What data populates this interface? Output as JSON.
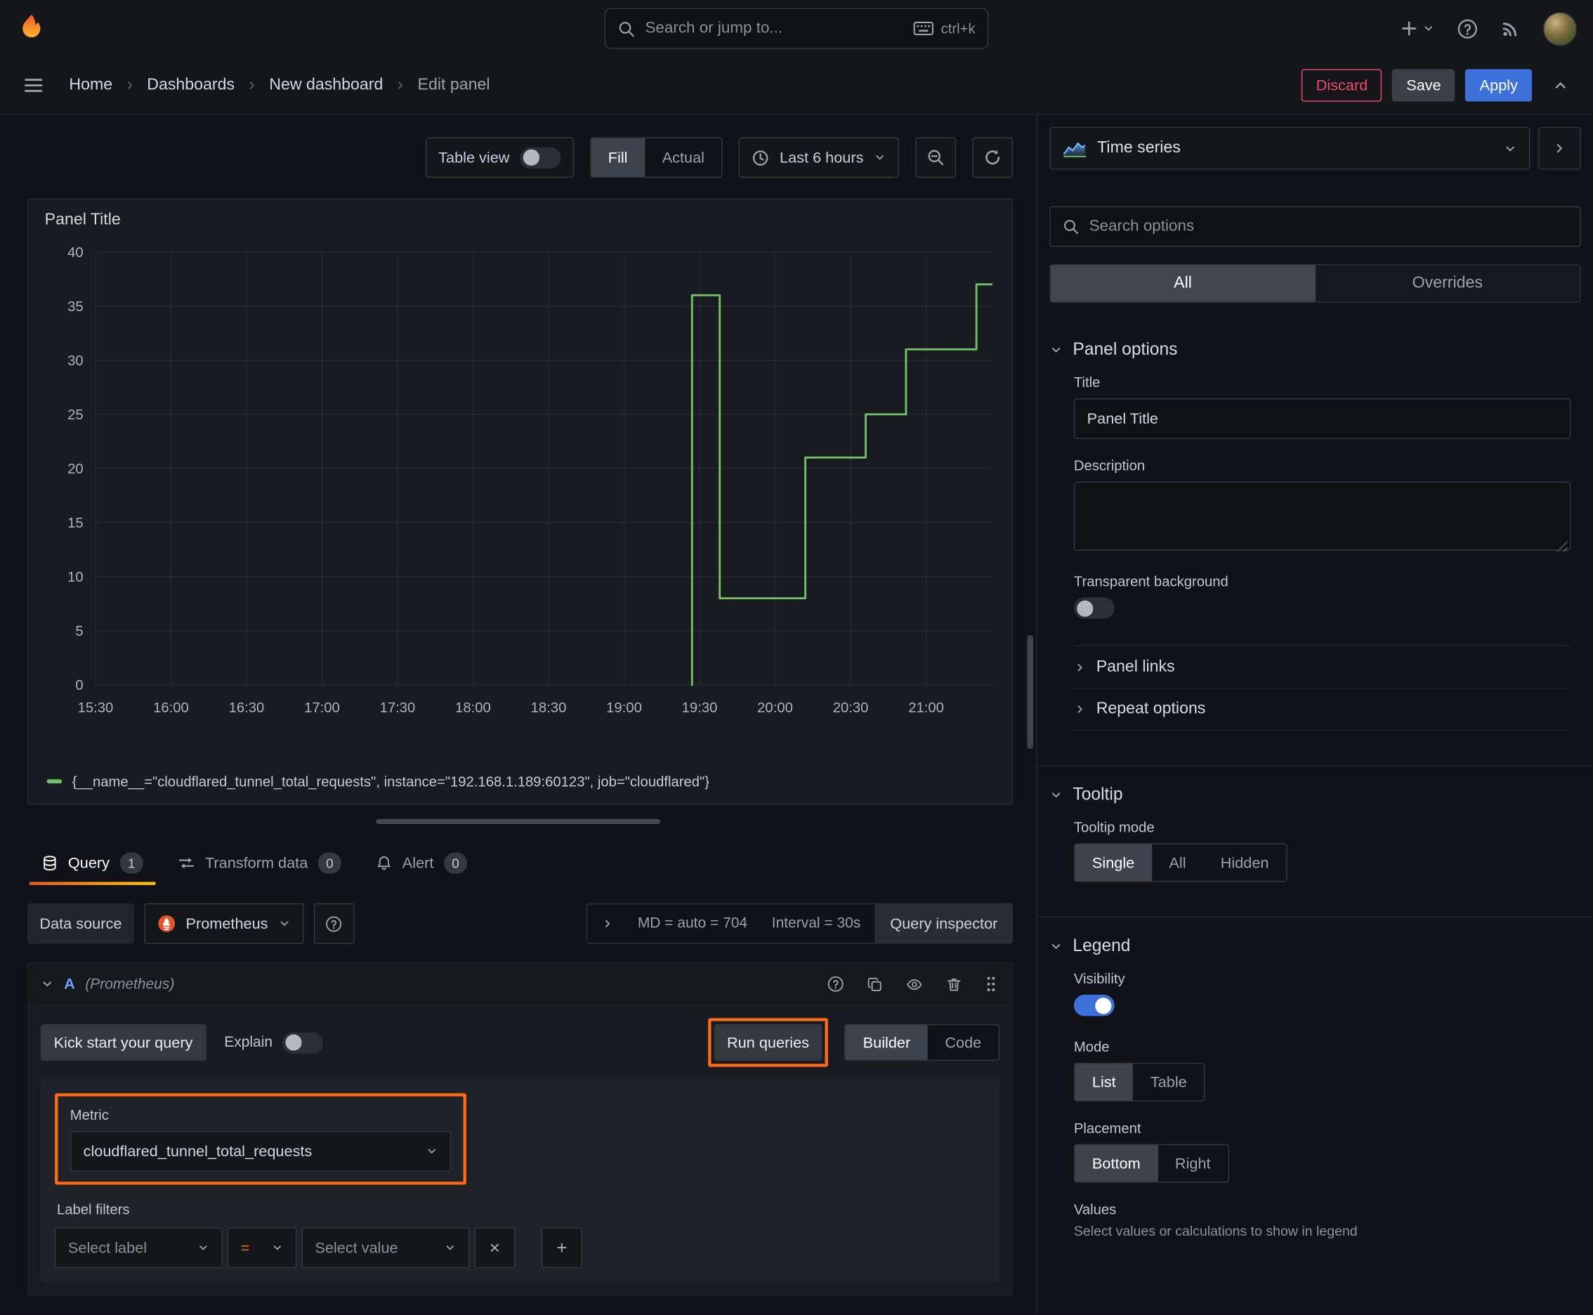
{
  "topbar": {
    "search_placeholder": "Search or jump to...",
    "shortcut": "ctrl+k"
  },
  "breadcrumb": {
    "items": [
      "Home",
      "Dashboards",
      "New dashboard",
      "Edit panel"
    ]
  },
  "nav_actions": {
    "discard": "Discard",
    "save": "Save",
    "apply": "Apply"
  },
  "view_toolbar": {
    "table_view": "Table view",
    "fill": "Fill",
    "actual": "Actual",
    "time_range": "Last 6 hours"
  },
  "panel": {
    "title": "Panel Title"
  },
  "chart_data": {
    "type": "line",
    "title": "Panel Title",
    "x_axis": {
      "range_min": [
        0,
        356
      ],
      "start_time": "15:30",
      "tick_minutes": [
        0,
        30,
        60,
        90,
        120,
        150,
        180,
        210,
        240,
        270,
        300,
        330
      ],
      "tick_labels": [
        "15:30",
        "16:00",
        "16:30",
        "17:00",
        "17:30",
        "18:00",
        "18:30",
        "19:00",
        "19:30",
        "20:00",
        "20:30",
        "21:00"
      ]
    },
    "y_axis": {
      "min": 0,
      "max": 40,
      "step": 5
    },
    "grid": true,
    "legend_position": "bottom",
    "series": [
      {
        "name": "{__name__=\"cloudflared_tunnel_total_requests\", instance=\"192.168.1.189:60123\", job=\"cloudflared\"}",
        "color": "#73bf69",
        "line_style": "step",
        "points": [
          [
            237,
            0
          ],
          [
            237,
            36
          ],
          [
            248,
            36
          ],
          [
            248,
            8
          ],
          [
            282,
            8
          ],
          [
            282,
            21
          ],
          [
            306,
            21
          ],
          [
            306,
            25
          ],
          [
            322,
            25
          ],
          [
            322,
            31
          ],
          [
            350,
            31
          ],
          [
            350,
            37
          ],
          [
            356,
            37
          ]
        ]
      }
    ]
  },
  "tabs": {
    "query": {
      "label": "Query",
      "count": "1"
    },
    "transform": {
      "label": "Transform data",
      "count": "0"
    },
    "alert": {
      "label": "Alert",
      "count": "0"
    }
  },
  "query": {
    "data_source_label": "Data source",
    "data_source_value": "Prometheus",
    "max_data_points": "MD = auto = 704",
    "interval": "Interval = 30s",
    "inspector": "Query inspector",
    "ref_id": "A",
    "ref_datasource": "(Prometheus)",
    "kick_start": "Kick start your query",
    "explain": "Explain",
    "run_queries": "Run queries",
    "builder": "Builder",
    "code": "Code",
    "metric_label": "Metric",
    "metric_value": "cloudflared_tunnel_total_requests",
    "label_filters_label": "Label filters",
    "select_label_placeholder": "Select label",
    "operator_value": "=",
    "select_value_placeholder": "Select value"
  },
  "sidebar": {
    "viz_name": "Time series",
    "options_search_placeholder": "Search options",
    "tabs": {
      "all": "All",
      "overrides": "Overrides"
    },
    "panel_options": {
      "header": "Panel options",
      "title_label": "Title",
      "title_value": "Panel Title",
      "description_label": "Description",
      "transparent_label": "Transparent background",
      "links_label": "Panel links",
      "repeat_label": "Repeat options"
    },
    "tooltip": {
      "header": "Tooltip",
      "mode_label": "Tooltip mode",
      "modes": [
        "Single",
        "All",
        "Hidden"
      ]
    },
    "legend": {
      "header": "Legend",
      "visibility_label": "Visibility",
      "mode_label": "Mode",
      "modes": [
        "List",
        "Table"
      ],
      "placement_label": "Placement",
      "placements": [
        "Bottom",
        "Right"
      ],
      "values_label": "Values",
      "values_help": "Select values or calculations to show in legend"
    }
  },
  "colors": {
    "accent_blue": "#3d71d9",
    "discard_red": "#f24a6e",
    "annot_orange": "#ff6a18",
    "operator_orange": "#eb7b18",
    "toggle_on": "#3d71d9",
    "ref_blue": "#6e9fff",
    "chart_green": "#73bf69",
    "tab_underline": "#ff780a"
  }
}
